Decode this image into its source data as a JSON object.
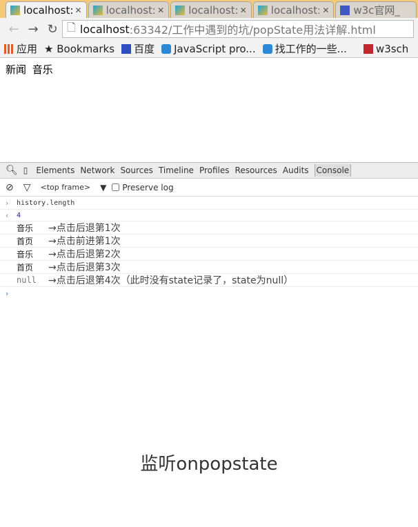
{
  "tabs": [
    {
      "label": "localhost:",
      "active": true,
      "icon": "folder-icon"
    },
    {
      "label": "localhost:",
      "icon": "folder-icon"
    },
    {
      "label": "localhost:",
      "icon": "folder-icon"
    },
    {
      "label": "localhost:",
      "icon": "folder-icon"
    },
    {
      "label": "w3c官网_",
      "icon": "paw-icon"
    }
  ],
  "address": {
    "host": "localhost",
    "path": ":63342/工作中遇到的坑/popState用法详解.html"
  },
  "bookmarks": [
    {
      "label": "应用",
      "color": "#e05a2b"
    },
    {
      "label": "Bookmarks",
      "color": "#555555"
    },
    {
      "label": "百度",
      "color": "#2f4fc0"
    },
    {
      "label": "JavaScript pro...",
      "color": "#2a8ad8"
    },
    {
      "label": "找工作的一些...",
      "color": "#2a8ad8"
    },
    {
      "label": "w3sch",
      "color": "#c0282e"
    }
  ],
  "page": {
    "links": [
      "新闻",
      "音乐"
    ]
  },
  "devtools": {
    "tabs": [
      "Elements",
      "Network",
      "Sources",
      "Timeline",
      "Profiles",
      "Resources",
      "Audits",
      "Console"
    ],
    "frame": "<top frame>",
    "preserve_log": "Preserve log"
  },
  "console": {
    "input": "history.length",
    "result": "4",
    "logs": [
      {
        "value": "音乐",
        "note": "→点击后退第1次"
      },
      {
        "value": "首页",
        "note": "→点击前进第1次"
      },
      {
        "value": "音乐",
        "note": "→点击后退第2次"
      },
      {
        "value": "首页",
        "note": "→点击后退第3次"
      },
      {
        "value": "null",
        "note": "→点击后退第4次（此时没有state记录了，state为null）"
      }
    ]
  },
  "caption": "监听onpopstate"
}
